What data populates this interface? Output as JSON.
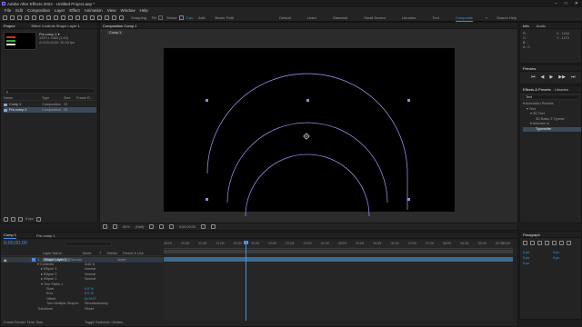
{
  "title_bar": {
    "title": "Adobe After Effects 2022 - Untitled Project.aep *",
    "controls": [
      "–",
      "□",
      "✕"
    ]
  },
  "menu": [
    "File",
    "Edit",
    "Composition",
    "Layer",
    "Effect",
    "Animation",
    "View",
    "Window",
    "Help"
  ],
  "toolbar": {
    "snapping": "Snapping",
    "fill_label": "Fill",
    "stroke_label": "Stroke",
    "stroke_px": "2 px",
    "add_label": "Add:",
    "bezier_label": "Bezier Path",
    "workspaces": [
      "Default",
      "Learn",
      "Standard",
      "Small Screen",
      "Libraries",
      "Text",
      "Composite"
    ],
    "active_workspace": "Composite",
    "search_placeholder": "Search Help"
  },
  "project_panel": {
    "tab": "Project",
    "effect_controls_tab": "Effect Controls Shape Layer 1",
    "item_name": "Pre-comp 1 ▾",
    "item_size": "1920 x 1080 (1.00)",
    "item_duration": "Δ 0;00;10;00, 30.00 fps",
    "search_placeholder": "ρ",
    "columns": [
      "Name",
      "Type",
      "Size",
      "Frame R..."
    ],
    "items": [
      {
        "name": "Comp 1",
        "type": "Composition",
        "fps": "25"
      },
      {
        "name": "Pre-comp 1",
        "type": "Composition",
        "fps": "25"
      }
    ],
    "footer_bpc": "8 bpc"
  },
  "composition_panel": {
    "tab": "Composition Comp 1",
    "breadcrumb": "Comp 1",
    "zoom": "50%",
    "resolution": "(Half)",
    "timecode": "0;00;00;00",
    "footer_items": [
      "50%",
      "(Half)",
      "0;00;00"
    ]
  },
  "info_panel": {
    "tabs": [
      "Info",
      "Audio"
    ],
    "values": [
      "R :",
      "G :",
      "B :",
      "A : 0"
    ],
    "coords": [
      "X : 1234",
      "Y : 1272"
    ]
  },
  "preview_panel": {
    "tab": "Preview",
    "buttons": [
      "⏮",
      "◀",
      "▶",
      "▶▶",
      "⏭"
    ]
  },
  "effects_panel": {
    "tabs": [
      "Effects & Presets",
      "Libraries",
      "Librar"
    ],
    "search_value": "Text",
    "tree": [
      {
        "label": "▾ Animation Presets",
        "level": 0
      },
      {
        "label": "▾ Text",
        "level": 1
      },
      {
        "label": "▾ 3D Text",
        "level": 2
      },
      {
        "label": "3D Basic Z Typewr",
        "level": 3
      },
      {
        "label": "▾ Animate In",
        "level": 2
      },
      {
        "label": "Typewriter",
        "level": 3,
        "selected": true
      }
    ]
  },
  "paragraph_panel": {
    "tab": "Paragraph",
    "values": [
      "0 px",
      "0 px",
      "0 px",
      "0 px",
      "0 px"
    ]
  },
  "timeline": {
    "tabs": [
      "Comp 1",
      "Pre-comp 1"
    ],
    "active_tab": "Comp 1",
    "timecode": "0;00;00;00",
    "columns": [
      "Layer Name",
      "Mode",
      "T",
      "TrkMat",
      "Parent & Link"
    ],
    "layer": {
      "num": "1",
      "name": "Shape Layer 1",
      "mode": "Normal",
      "parent": "None"
    },
    "rows": [
      {
        "label": "▾ Contents",
        "value": "Add: ●",
        "indent": 1
      },
      {
        "label": "▸ Ellipse 3",
        "value": "Normal",
        "indent": 2
      },
      {
        "label": "▸ Ellipse 2",
        "value": "Normal",
        "indent": 2
      },
      {
        "label": "▸ Ellipse 1",
        "value": "Normal",
        "indent": 2
      },
      {
        "label": "▾ Trim Paths 1",
        "value": "",
        "indent": 2
      },
      {
        "label": "Start",
        "value": "0.0 %",
        "indent": 3
      },
      {
        "label": "End",
        "value": "0.0 %",
        "indent": 3
      },
      {
        "label": "Offset",
        "value": "0x+0.0°",
        "indent": 3
      },
      {
        "label": "Trim Multiple Shapes",
        "value": "Simultaneously",
        "indent": 3
      },
      {
        "label": "Transform",
        "value": "Reset",
        "indent": 1
      }
    ],
    "ruler_ticks": [
      "00:00f",
      "00:15f",
      "01:00f",
      "01:15f",
      "02:00f",
      "02:15f",
      "03:00f",
      "03:15f",
      "04:00f",
      "04:15f",
      "05:00f",
      "05:15f",
      "06:00f",
      "06:15f",
      "07:00f",
      "07:15f",
      "08:00f",
      "08:15f",
      "09:00f",
      "09:15f",
      "10:00f"
    ],
    "footer": [
      "Frame Render Time: 5ms",
      "Toggle Switches / Modes"
    ]
  }
}
